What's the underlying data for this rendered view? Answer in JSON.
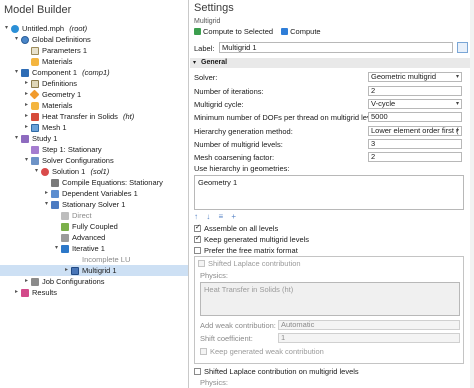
{
  "left": {
    "title": "Model Builder",
    "tree": [
      {
        "label": "Untitled.mph",
        "suffix": "(root)",
        "icon": "i-file",
        "tog": "▾",
        "indent": 0,
        "name": "tree-root"
      },
      {
        "label": "Global Definitions",
        "suffix": "",
        "icon": "i-globe",
        "tog": "▾",
        "indent": 1,
        "name": "tree-global-definitions"
      },
      {
        "label": "Parameters 1",
        "suffix": "",
        "icon": "i-param",
        "tog": "",
        "indent": 2,
        "name": "tree-parameters-1"
      },
      {
        "label": "Materials",
        "suffix": "",
        "icon": "i-mat",
        "tog": "",
        "indent": 2,
        "name": "tree-global-materials"
      },
      {
        "label": "Component 1",
        "suffix": "(comp1)",
        "icon": "i-comp",
        "tog": "▾",
        "indent": 1,
        "name": "tree-component-1"
      },
      {
        "label": "Definitions",
        "suffix": "",
        "icon": "i-def",
        "tog": "▸",
        "indent": 2,
        "name": "tree-definitions"
      },
      {
        "label": "Geometry 1",
        "suffix": "",
        "icon": "i-geo",
        "tog": "▸",
        "indent": 2,
        "name": "tree-geometry-1"
      },
      {
        "label": "Materials",
        "suffix": "",
        "icon": "i-mat",
        "tog": "▸",
        "indent": 2,
        "name": "tree-materials"
      },
      {
        "label": "Heat Transfer in Solids",
        "suffix": "(ht)",
        "icon": "i-heat",
        "tog": "▸",
        "indent": 2,
        "name": "tree-heat-transfer"
      },
      {
        "label": "Mesh 1",
        "suffix": "",
        "icon": "i-mesh",
        "tog": "▸",
        "indent": 2,
        "name": "tree-mesh-1"
      },
      {
        "label": "Study 1",
        "suffix": "",
        "icon": "i-study",
        "tog": "▾",
        "indent": 1,
        "name": "tree-study-1"
      },
      {
        "label": "Step 1: Stationary",
        "suffix": "",
        "icon": "i-step",
        "tog": "",
        "indent": 2,
        "name": "tree-step-1"
      },
      {
        "label": "Solver Configurations",
        "suffix": "",
        "icon": "i-solcfg",
        "tog": "▾",
        "indent": 2,
        "name": "tree-solver-configurations"
      },
      {
        "label": "Solution 1",
        "suffix": "(sol1)",
        "icon": "i-sol",
        "tog": "▾",
        "indent": 3,
        "name": "tree-solution-1"
      },
      {
        "label": "Compile Equations: Stationary",
        "suffix": "",
        "icon": "i-compile",
        "tog": "",
        "indent": 4,
        "name": "tree-compile-equations"
      },
      {
        "label": "Dependent Variables 1",
        "suffix": "",
        "icon": "i-depvar",
        "tog": "▸",
        "indent": 4,
        "name": "tree-dependent-variables"
      },
      {
        "label": "Stationary Solver 1",
        "suffix": "",
        "icon": "i-solver",
        "tog": "▾",
        "indent": 4,
        "name": "tree-stationary-solver"
      },
      {
        "label": "Direct",
        "suffix": "",
        "icon": "i-direct",
        "tog": "",
        "indent": 5,
        "name": "tree-direct",
        "dis": true
      },
      {
        "label": "Fully Coupled",
        "suffix": "",
        "icon": "i-fully",
        "tog": "",
        "indent": 5,
        "name": "tree-fully-coupled"
      },
      {
        "label": "Advanced",
        "suffix": "",
        "icon": "i-adv",
        "tog": "",
        "indent": 5,
        "name": "tree-advanced"
      },
      {
        "label": "Iterative 1",
        "suffix": "",
        "icon": "i-iter",
        "tog": "▾",
        "indent": 5,
        "name": "tree-iterative-1"
      },
      {
        "label": "Incomplete LU",
        "suffix": "",
        "icon": "",
        "tog": "",
        "indent": 6,
        "name": "tree-incomplete-lu",
        "dis": true
      },
      {
        "label": "Multigrid 1",
        "suffix": "",
        "icon": "i-mg",
        "tog": "▸",
        "indent": 6,
        "name": "tree-multigrid-1",
        "sel": true
      },
      {
        "label": "Job Configurations",
        "suffix": "",
        "icon": "i-job",
        "tog": "▸",
        "indent": 2,
        "name": "tree-job-configurations"
      },
      {
        "label": "Results",
        "suffix": "",
        "icon": "i-res",
        "tog": "▸",
        "indent": 1,
        "name": "tree-results"
      }
    ]
  },
  "right": {
    "title": "Settings",
    "subtitle": "Multigrid",
    "compute_to_selected": "Compute to Selected",
    "compute": "Compute",
    "label_caption": "Label:",
    "label_value": "Multigrid 1",
    "section_general": "General",
    "fields": [
      {
        "label": "Solver:",
        "value": "Geometric multigrid",
        "select": true
      },
      {
        "label": "Number of iterations:",
        "value": "2",
        "select": false
      },
      {
        "label": "Multigrid cycle:",
        "value": "V-cycle",
        "select": true
      },
      {
        "label": "Minimum number of DOFs per thread on multigrid levels:",
        "value": "5000",
        "select": false
      },
      {
        "label": "Hierarchy generation method:",
        "value": "Lower element order first (",
        "select": true
      },
      {
        "label": "Number of multigrid levels:",
        "value": "3",
        "select": false
      },
      {
        "label": "Mesh coarsening factor:",
        "value": "2",
        "select": false
      }
    ],
    "use_hierarchy_label": "Use hierarchy in geometries:",
    "geometry_item": "Geometry 1",
    "toolbar_glyphs": "↑ ↓ ≡ +",
    "assemble_all": "Assemble on all levels",
    "keep_generated": "Keep generated multigrid levels",
    "prefer_free": "Prefer the free matrix format",
    "shifted_laplace": "Shifted Laplace contribution",
    "physics_label": "Physics:",
    "physics_item": "Heat Transfer in Solids (ht)",
    "add_weak_label": "Add weak contribution:",
    "add_weak_value": "Automatic",
    "shift_coeff_label": "Shift coefficient:",
    "shift_coeff_value": "1",
    "keep_weak": "Keep generated weak contribution",
    "shifted_laplace_levels": "Shifted Laplace contribution on multigrid levels",
    "physics_label_2": "Physics:"
  },
  "colors": {
    "selection": "#cde0f4",
    "section_bg": "#e9e9e9",
    "accent": "#2f7ed8"
  }
}
